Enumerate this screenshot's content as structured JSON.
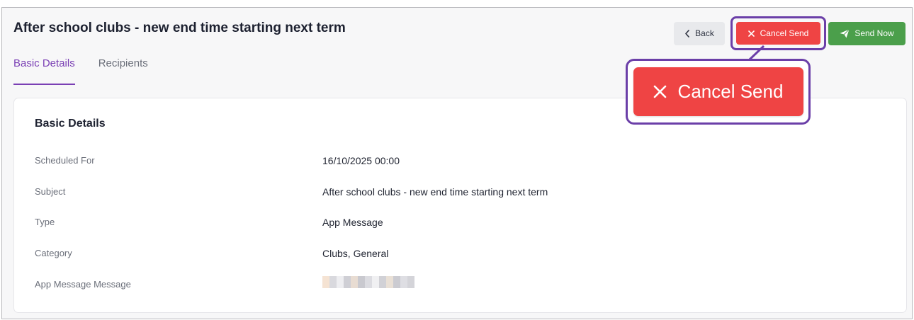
{
  "header": {
    "title": "After school clubs - new end time starting next term",
    "back_label": "Back",
    "cancel_label": "Cancel Send",
    "send_label": "Send Now"
  },
  "tabs": [
    {
      "label": "Basic Details",
      "active": true
    },
    {
      "label": "Recipients",
      "active": false
    }
  ],
  "details": {
    "title": "Basic Details",
    "rows": [
      {
        "label": "Scheduled For",
        "value": "16/10/2025 00:00"
      },
      {
        "label": "Subject",
        "value": "After school clubs - new end time starting next term"
      },
      {
        "label": "Type",
        "value": "App Message"
      },
      {
        "label": "Category",
        "value": "Clubs, General"
      },
      {
        "label": "App Message Message",
        "value": ""
      }
    ]
  },
  "callout": {
    "label": "Cancel Send"
  },
  "icons": {
    "back": "chevron-left-icon",
    "cancel": "close-icon",
    "send": "paper-plane-icon"
  },
  "colors": {
    "accent": "#7a3fb4",
    "highlight_border": "#6b3fa8",
    "danger": "#ef4444",
    "success": "#4b9f4b"
  }
}
